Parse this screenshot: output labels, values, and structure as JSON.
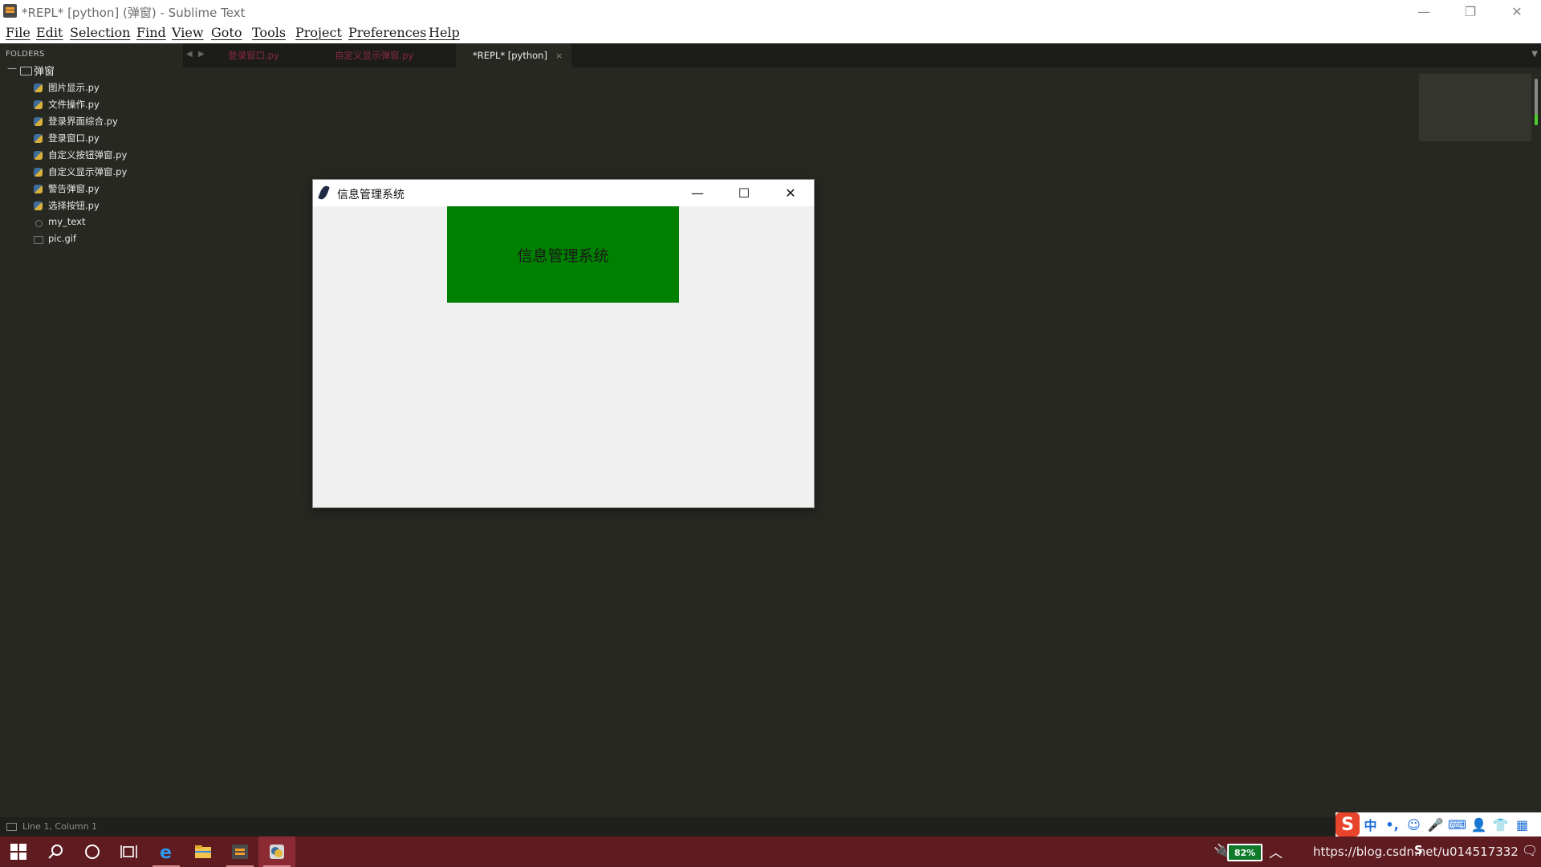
{
  "window": {
    "title": "*REPL* [python] (弹窗) - Sublime Text",
    "minimize_glyph": "—",
    "maximize_glyph": "❐",
    "close_glyph": "✕"
  },
  "menu": [
    "File",
    "Edit",
    "Selection",
    "Find",
    "View",
    "Goto",
    "Tools",
    "Project",
    "Preferences",
    "Help"
  ],
  "sidebar": {
    "header": "FOLDERS",
    "folder": {
      "name": "弹窗",
      "expanded_glyph": "—"
    },
    "files": [
      {
        "name": "图片显示.py",
        "icon": "python-file-icon"
      },
      {
        "name": "文件操作.py",
        "icon": "python-file-icon"
      },
      {
        "name": "登录界面综合.py",
        "icon": "python-file-icon"
      },
      {
        "name": "登录窗口.py",
        "icon": "python-file-icon"
      },
      {
        "name": "自定义按钮弹窗.py",
        "icon": "python-file-icon"
      },
      {
        "name": "自定义显示弹窗.py",
        "icon": "python-file-icon"
      },
      {
        "name": "警告弹窗.py",
        "icon": "python-file-icon"
      },
      {
        "name": "选择按钮.py",
        "icon": "python-file-icon"
      },
      {
        "name": "my_text",
        "icon": "text-file-icon"
      },
      {
        "name": "pic.gif",
        "icon": "image-file-icon"
      }
    ]
  },
  "tabs": {
    "items": [
      {
        "label": "登录窗口.py",
        "active": false
      },
      {
        "label": "自定义显示弹窗.py",
        "active": false
      },
      {
        "label": "*REPL* [python]",
        "active": true
      }
    ],
    "close_glyph": "×",
    "prev_glyph": "◀",
    "next_glyph": "▶",
    "dropdown_glyph": "▼"
  },
  "tk_window": {
    "title": "信息管理系统",
    "label_text": "信息管理系统",
    "label_bg": "#008000",
    "minimize_glyph": "—",
    "maximize_glyph": "☐",
    "close_glyph": "✕"
  },
  "statusbar": {
    "position": "Line 1, Column 1"
  },
  "ime": {
    "logo": "S",
    "items": [
      "中",
      "•,",
      "☺",
      "🎤",
      "⌨",
      "👤",
      "👕",
      "▦"
    ]
  },
  "taskbar": {
    "battery": "82%",
    "tray_overlay": "https://blog.csdn.net/u014517332",
    "tray_ime": "S",
    "chevron_glyph": "︿",
    "plug_glyph": "🔌",
    "notify_glyph": "🗨"
  },
  "colors": {
    "editor_bg": "#272822",
    "taskbar_bg": "#5e1b20",
    "inactive_tab_text": "#8b2b40"
  }
}
